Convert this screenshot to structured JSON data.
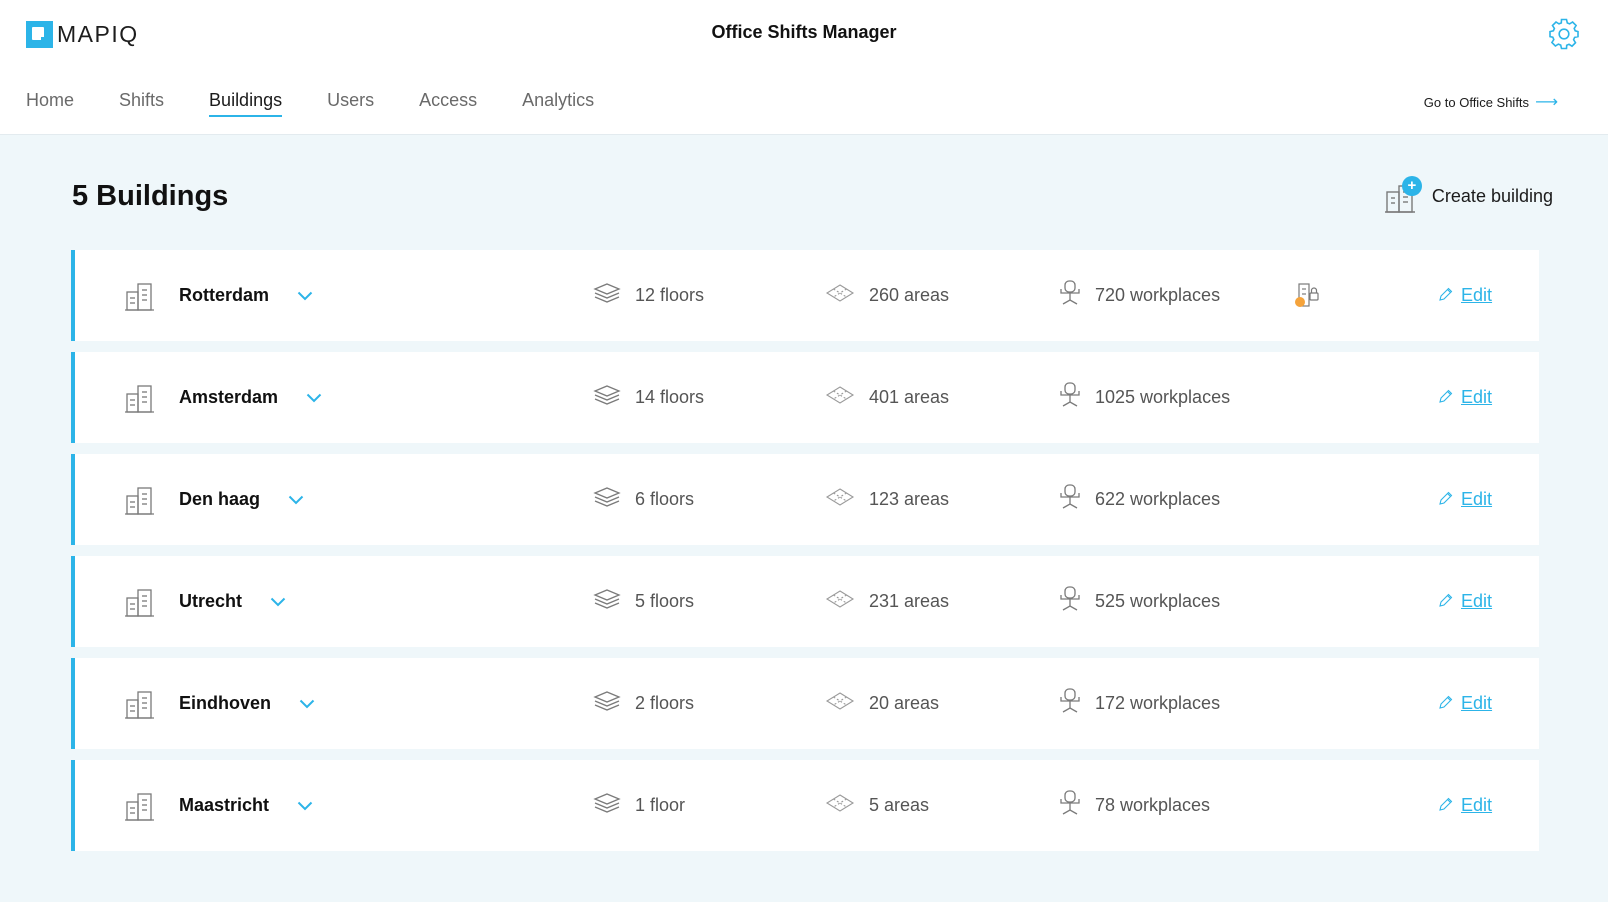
{
  "header": {
    "logo_text": "MAPIQ",
    "app_title": "Office Shifts Manager",
    "settings_icon": "gear-icon"
  },
  "nav": {
    "items": [
      "Home",
      "Shifts",
      "Buildings",
      "Users",
      "Access",
      "Analytics"
    ],
    "active": "Buildings",
    "goto_label": "Go to Office Shifts"
  },
  "main": {
    "title": "5 Buildings",
    "create_label": "Create building",
    "edit_label": "Edit",
    "accent_color": "#2cb4e8",
    "alert_color": "#f5a33b",
    "buildings": [
      {
        "name": "Rotterdam",
        "floors": "12 floors",
        "areas": "260 areas",
        "workplaces": "720 workplaces",
        "has_lock_alert": true
      },
      {
        "name": "Amsterdam",
        "floors": "14 floors",
        "areas": "401 areas",
        "workplaces": "1025 workplaces",
        "has_lock_alert": false
      },
      {
        "name": "Den haag",
        "floors": "6 floors",
        "areas": "123 areas",
        "workplaces": "622 workplaces",
        "has_lock_alert": false
      },
      {
        "name": "Utrecht",
        "floors": "5 floors",
        "areas": "231 areas",
        "workplaces": "525 workplaces",
        "has_lock_alert": false
      },
      {
        "name": "Eindhoven",
        "floors": "2 floors",
        "areas": "20 areas",
        "workplaces": "172 workplaces",
        "has_lock_alert": false
      },
      {
        "name": "Maastricht",
        "floors": "1 floor",
        "areas": "5 areas",
        "workplaces": "78 workplaces",
        "has_lock_alert": false
      }
    ]
  }
}
